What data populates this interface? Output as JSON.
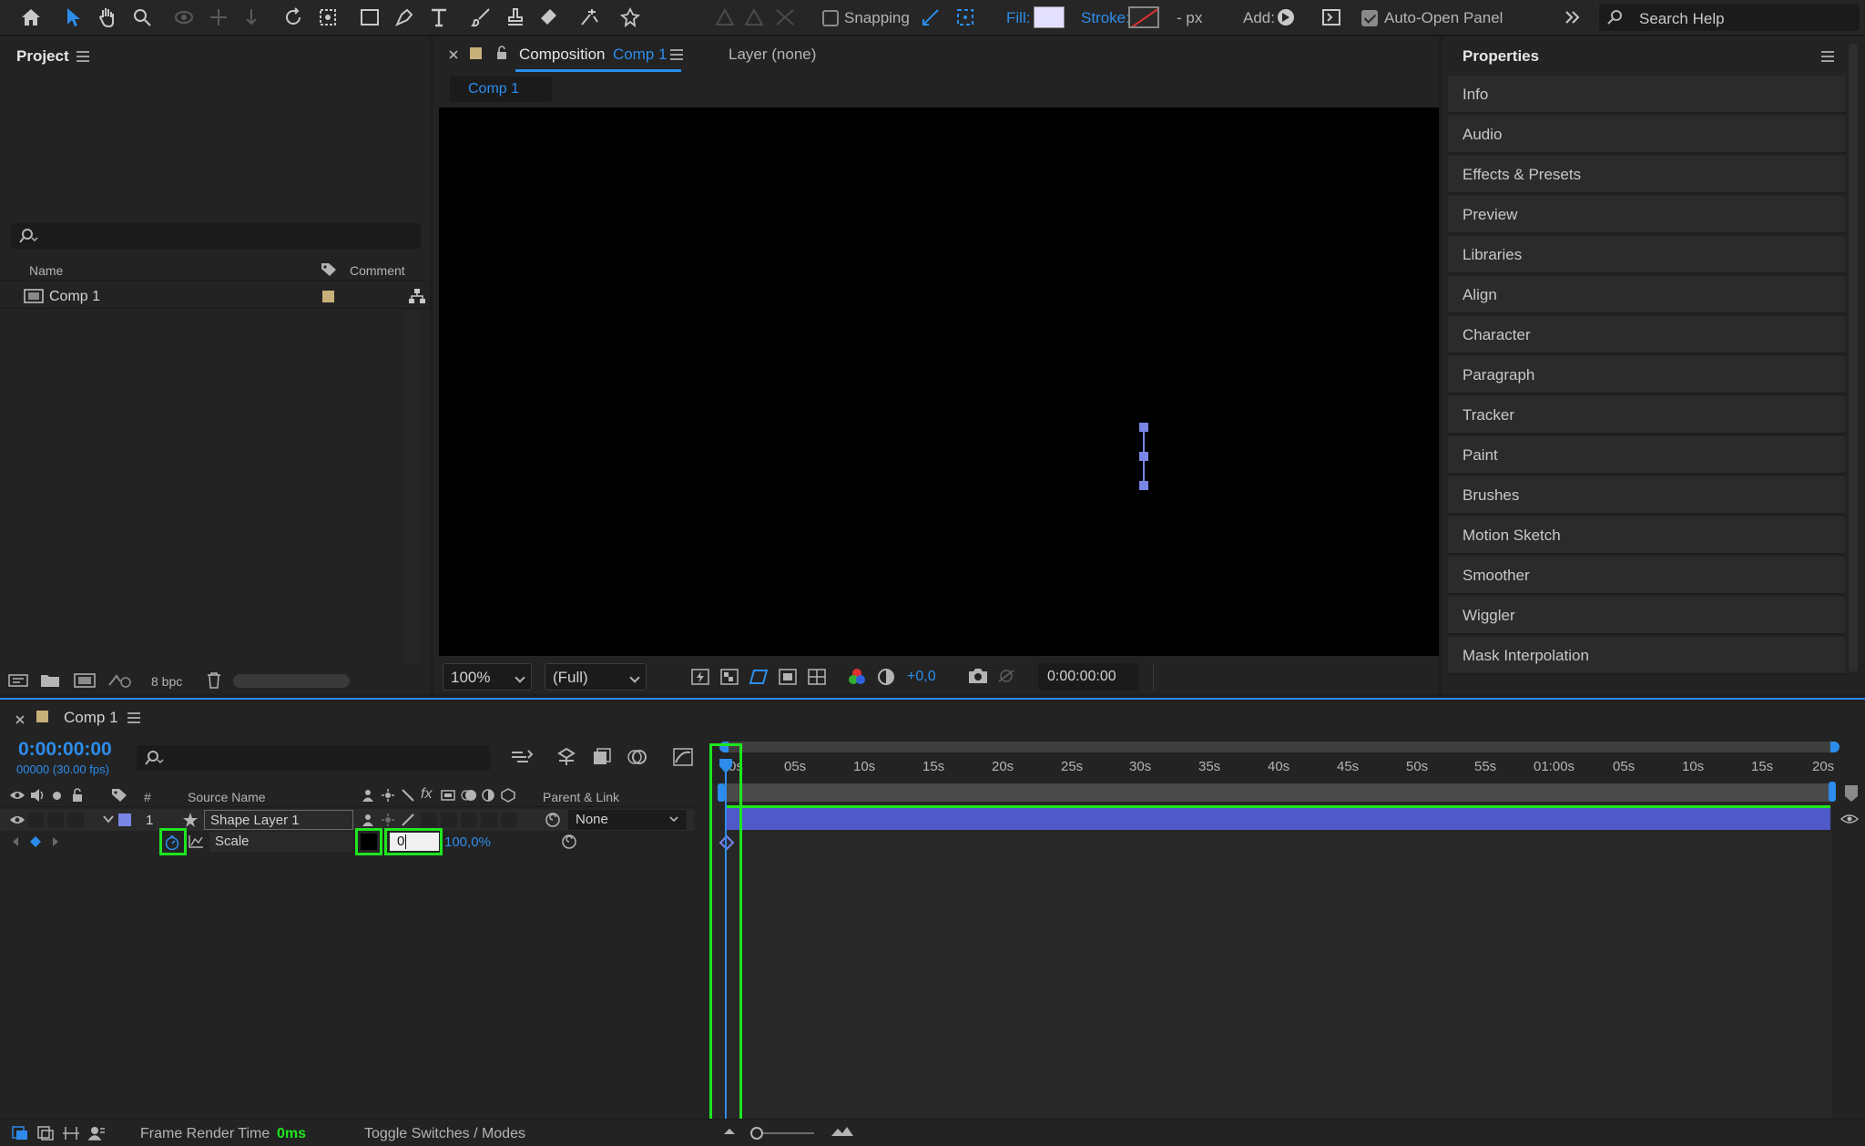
{
  "toolbar": {
    "snapping_label": "Snapping",
    "fill_label": "Fill:",
    "stroke_label": "Stroke:",
    "stroke_width": "- px",
    "add_label": "Add:",
    "auto_open_label": "Auto-Open Panel",
    "search_placeholder": "Search Help"
  },
  "project": {
    "title": "Project",
    "columns": {
      "name": "Name",
      "comment": "Comment"
    },
    "items": [
      {
        "name": "Comp 1"
      }
    ],
    "bpc_label": "8 bpc"
  },
  "composition": {
    "tab_prefix": "Composition",
    "tab_name": "Comp 1",
    "layer_tab": "Layer (none)",
    "subtab": "Comp 1",
    "zoom": "100%",
    "resolution": "(Full)",
    "exposure": "+0,0",
    "timecode": "0:00:00:00"
  },
  "properties": {
    "title": "Properties",
    "items": [
      "Info",
      "Audio",
      "Effects & Presets",
      "Preview",
      "Libraries",
      "Align",
      "Character",
      "Paragraph",
      "Tracker",
      "Paint",
      "Brushes",
      "Motion Sketch",
      "Smoother",
      "Wiggler",
      "Mask Interpolation"
    ]
  },
  "timeline": {
    "comp_name": "Comp 1",
    "timecode": "0:00:00:00",
    "frame_info": "00000 (30.00 fps)",
    "col_num": "#",
    "col_source": "Source Name",
    "col_parent": "Parent & Link",
    "layer": {
      "num": "1",
      "name": "Shape Layer 1",
      "parent": "None"
    },
    "property": {
      "name": "Scale",
      "value_editing": "0",
      "value_display": "100,0%"
    },
    "ruler_labels": [
      "0s",
      "05s",
      "10s",
      "15s",
      "20s",
      "25s",
      "30s",
      "35s",
      "40s",
      "45s",
      "50s",
      "55s",
      "01:00s",
      "05s",
      "10s",
      "15s",
      "20s"
    ],
    "footer_render_label": "Frame Render Time",
    "footer_render_value": "0ms",
    "footer_toggle": "Toggle Switches / Modes"
  },
  "colors": {
    "accent": "#2d8ceb",
    "layer_bar": "#4f5ac8",
    "highlight": "#1ee61e",
    "comp_label": "#c8b07a",
    "layer_label": "#7a86e6"
  }
}
